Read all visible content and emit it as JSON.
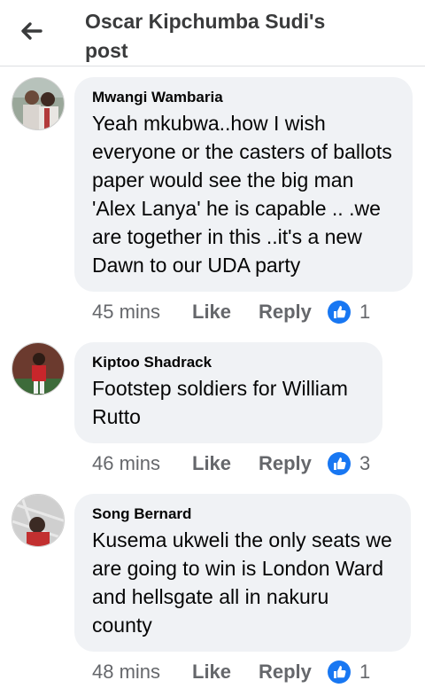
{
  "header": {
    "back_icon": "arrow-left-icon",
    "title": "Oscar Kipchumba Sudi's post"
  },
  "comments": [
    {
      "author": "Mwangi Wambaria",
      "text": "Yeah mkubwa..how I wish everyone or the casters of ballots paper would see the big man 'Alex Lanya' he is capable .. .we are together in this ..it's a new Dawn to our UDA party",
      "time": "45 mins",
      "like_label": "Like",
      "reply_label": "Reply",
      "reaction_icon": "thumbs-up-icon",
      "reaction_count": "1"
    },
    {
      "author": "Kiptoo Shadrack",
      "text": "Footstep soldiers for William Rutto",
      "time": "46 mins",
      "like_label": "Like",
      "reply_label": "Reply",
      "reaction_icon": "thumbs-up-icon",
      "reaction_count": "3"
    },
    {
      "author": "Song Bernard",
      "text": "Kusema ukweli the only seats we are going to win is London Ward and hellsgate all in nakuru county",
      "time": "48 mins",
      "like_label": "Like",
      "reply_label": "Reply",
      "reaction_icon": "thumbs-up-icon",
      "reaction_count": "1"
    }
  ],
  "colors": {
    "reaction_blue": "#1877f2",
    "bubble_bg": "#f0f2f5",
    "meta_gray": "#65676b"
  }
}
